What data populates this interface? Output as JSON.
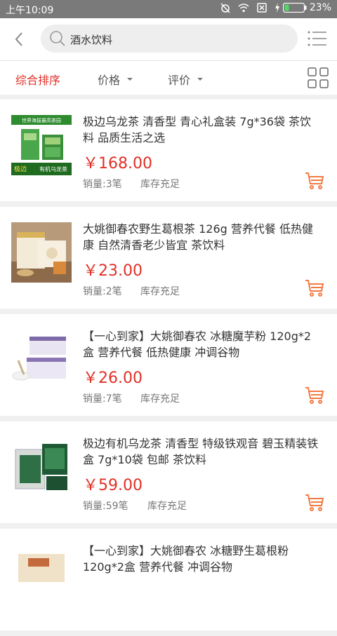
{
  "status_bar": {
    "time": "上午10:09",
    "battery_percent": "23%",
    "battery_level": 0.23
  },
  "header": {
    "search_value": "酒水饮料"
  },
  "sort_bar": {
    "items": [
      {
        "label": "综合排序",
        "active": true
      },
      {
        "label": "价格"
      },
      {
        "label": "评价"
      }
    ]
  },
  "colors": {
    "accent": "#e03127",
    "cart": "#f27b43",
    "status_bar": "#7a7a7a"
  },
  "products": [
    {
      "title": "极边乌龙茶 清香型 青心礼盒装 7g*36袋 茶饮料 品质生活之选",
      "price": "￥168.00",
      "sales": "销量:3笔",
      "stock": "库存充足",
      "image_texts": [
        "世界海拔最高茶园",
        "极边",
        "有机乌龙茶"
      ]
    },
    {
      "title": "大姚御春农野生葛根茶 126g 营养代餐 低热健康 自然清香老少皆宜 茶饮料",
      "price": "￥23.00",
      "sales": "销量:2笔",
      "stock": "库存充足"
    },
    {
      "title": "【一心到家】大姚御春农 冰糖魔芋粉 120g*2盒 营养代餐 低热健康 冲调谷物",
      "price": "￥26.00",
      "sales": "销量:7笔",
      "stock": "库存充足"
    },
    {
      "title": "极边有机乌龙茶 清香型 特级铁观音 碧玉精装铁盒 7g*10袋 包邮 茶饮料",
      "price": "￥59.00",
      "sales": "销量:59笔",
      "stock": "库存充足"
    },
    {
      "title": "【一心到家】大姚御春农 冰糖野生葛根粉 120g*2盒 营养代餐 冲调谷物",
      "price": "",
      "sales": "",
      "stock": ""
    }
  ]
}
